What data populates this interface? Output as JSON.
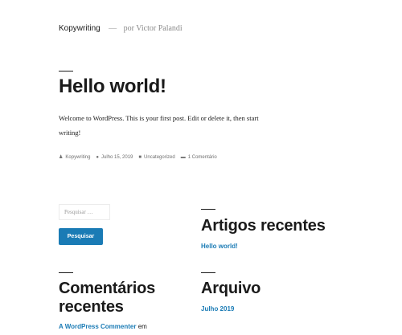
{
  "site": {
    "title": "Kopywriting",
    "separator": "—",
    "description": "por Victor Palandi"
  },
  "post": {
    "title": "Hello world!",
    "content": "Welcome to WordPress. This is your first post. Edit or delete it, then start writing!",
    "meta": {
      "author": "Kopywriting",
      "date": "Julho 15, 2019",
      "category": "Uncategorized",
      "comments": "1 Comentário"
    }
  },
  "search": {
    "placeholder": "Pesquisar …",
    "button_label": "Pesquisar"
  },
  "widgets": {
    "recent_posts": {
      "title": "Artigos recentes",
      "items": [
        "Hello world!"
      ]
    },
    "recent_comments": {
      "title_line1": "Comentários",
      "title_line2": "recentes",
      "author_link": "A WordPress Commenter",
      "connector": "em"
    },
    "archives": {
      "title": "Arquivo",
      "items": [
        "Julho 2019"
      ]
    }
  },
  "colors": {
    "link": "#1a7bb5",
    "button": "#1a7bb5",
    "text": "#1a1a1a"
  }
}
